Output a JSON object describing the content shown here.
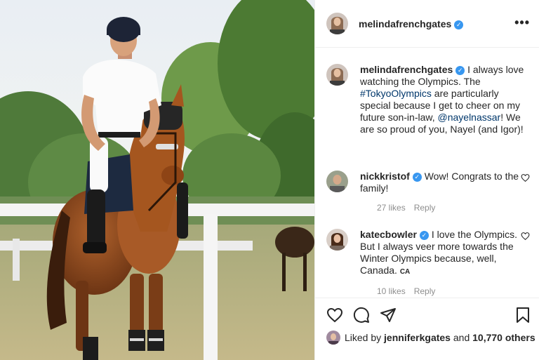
{
  "post": {
    "username": "melindafrenchgates",
    "verified_icon": "verified-badge-icon",
    "more_icon": "more-options-icon",
    "more_label": "•••"
  },
  "caption": {
    "username": "melindafrenchgates",
    "text_1": "I always love watching the Olympics. The ",
    "hashtag": "#TokyoOlympics",
    "text_2": " are particularly special because I get to cheer on my future son-in-law, ",
    "mention": "@nayelnassar",
    "text_3": "! We are so proud of you, Nayel (and Igor)!"
  },
  "comments": [
    {
      "username": "nickkristof",
      "text": "Wow! Congrats to the family!",
      "likes": "27 likes",
      "reply": "Reply"
    },
    {
      "username": "katecbowler",
      "text": "I love the Olympics. But I always veer more towards the Winter Olympics because, well, Canada. ",
      "flag_text": "CA",
      "likes": "10 likes",
      "reply": "Reply"
    }
  ],
  "actions": {
    "icons": [
      "heart-icon",
      "comment-icon",
      "share-icon",
      "bookmark-icon"
    ]
  },
  "likes_line": {
    "prefix": "Liked by ",
    "user": "jenniferkgates",
    "middle": " and ",
    "count": "10,770 others"
  },
  "colors": {
    "verified": "#3897f0",
    "link": "#00376b",
    "muted": "#8e8e8e",
    "text": "#262626"
  }
}
